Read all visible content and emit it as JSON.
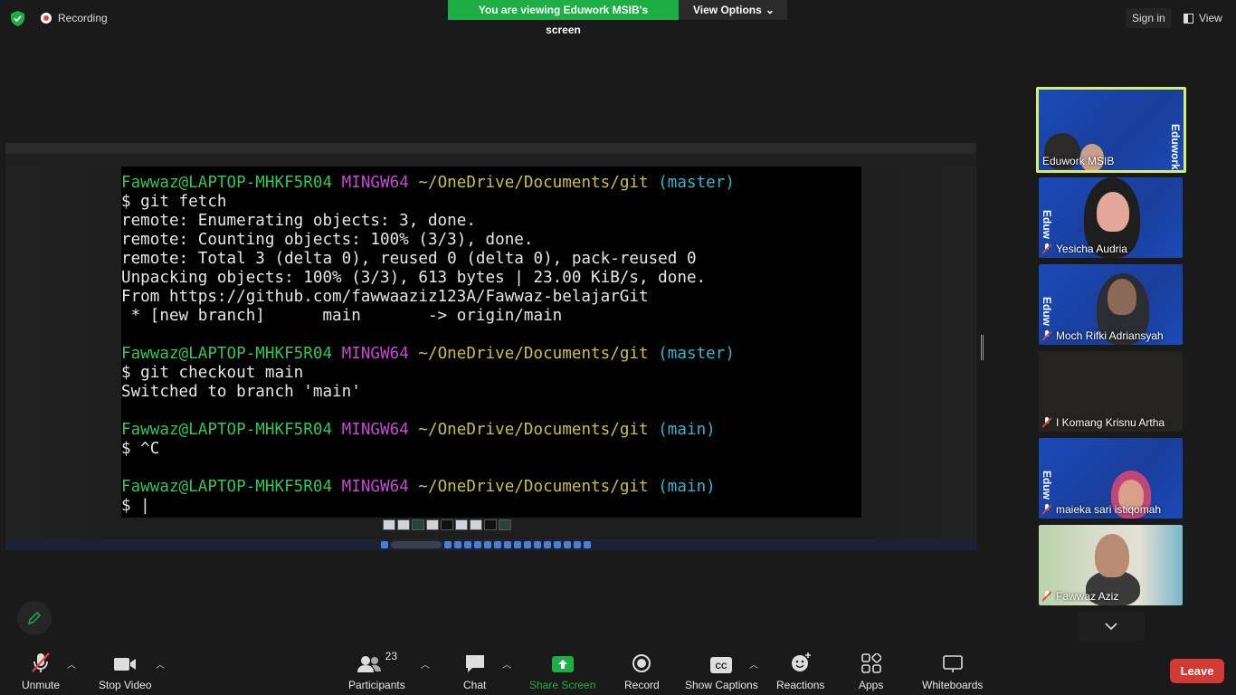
{
  "top": {
    "recording_label": "Recording",
    "viewing_banner": "You are viewing Eduwork MSIB's screen",
    "view_options": "View Options",
    "sign_in": "Sign in",
    "view": "View"
  },
  "terminal": {
    "lines": [
      {
        "user": "Fawwaz@LAPTOP-MHKF5R04",
        "host": "MINGW64",
        "path": "~/OneDrive/Documents/git",
        "branch": "(master)"
      },
      {
        "text": "$ git fetch"
      },
      {
        "text": "remote: Enumerating objects: 3, done."
      },
      {
        "text": "remote: Counting objects: 100% (3/3), done."
      },
      {
        "text": "remote: Total 3 (delta 0), reused 0 (delta 0), pack-reused 0"
      },
      {
        "text": "Unpacking objects: 100% (3/3), 613 bytes | 23.00 KiB/s, done."
      },
      {
        "text": "From https://github.com/fawwaaziz123A/Fawwaz-belajarGit"
      },
      {
        "text": " * [new branch]      main       -> origin/main"
      },
      {
        "text": ""
      },
      {
        "user": "Fawwaz@LAPTOP-MHKF5R04",
        "host": "MINGW64",
        "path": "~/OneDrive/Documents/git",
        "branch": "(master)"
      },
      {
        "text": "$ git checkout main"
      },
      {
        "text": "Switched to branch 'main'"
      },
      {
        "text": ""
      },
      {
        "user": "Fawwaz@LAPTOP-MHKF5R04",
        "host": "MINGW64",
        "path": "~/OneDrive/Documents/git",
        "branch": "(main)"
      },
      {
        "text": "$ ^C"
      },
      {
        "text": ""
      },
      {
        "user": "Fawwaz@LAPTOP-MHKF5R04",
        "host": "MINGW64",
        "path": "~/OneDrive/Documents/git",
        "branch": "(main)"
      },
      {
        "text": "$ |"
      }
    ]
  },
  "participants": [
    {
      "name": "Eduwork MSIB",
      "muted": false,
      "active": true
    },
    {
      "name": "Yesicha Audria",
      "muted": true
    },
    {
      "name": "Moch Rifki Adriansyah",
      "muted": true
    },
    {
      "name": "I Komang Krisnu Artha",
      "muted": true
    },
    {
      "name": "maieka sari istiqomah",
      "muted": true
    },
    {
      "name": "Fawwaz Aziz",
      "muted": true
    }
  ],
  "toolbar": {
    "unmute": "Unmute",
    "stop_video": "Stop Video",
    "participants": "Participants",
    "participants_count": "23",
    "chat": "Chat",
    "share_screen": "Share Screen",
    "record": "Record",
    "show_captions": "Show Captions",
    "reactions": "Reactions",
    "apps": "Apps",
    "whiteboards": "Whiteboards",
    "leave": "Leave"
  },
  "colors": {
    "banner_green": "#1eae45",
    "share_green": "#1eae45",
    "leave_red": "#d13b34",
    "active_speaker": "#d6f06a"
  }
}
